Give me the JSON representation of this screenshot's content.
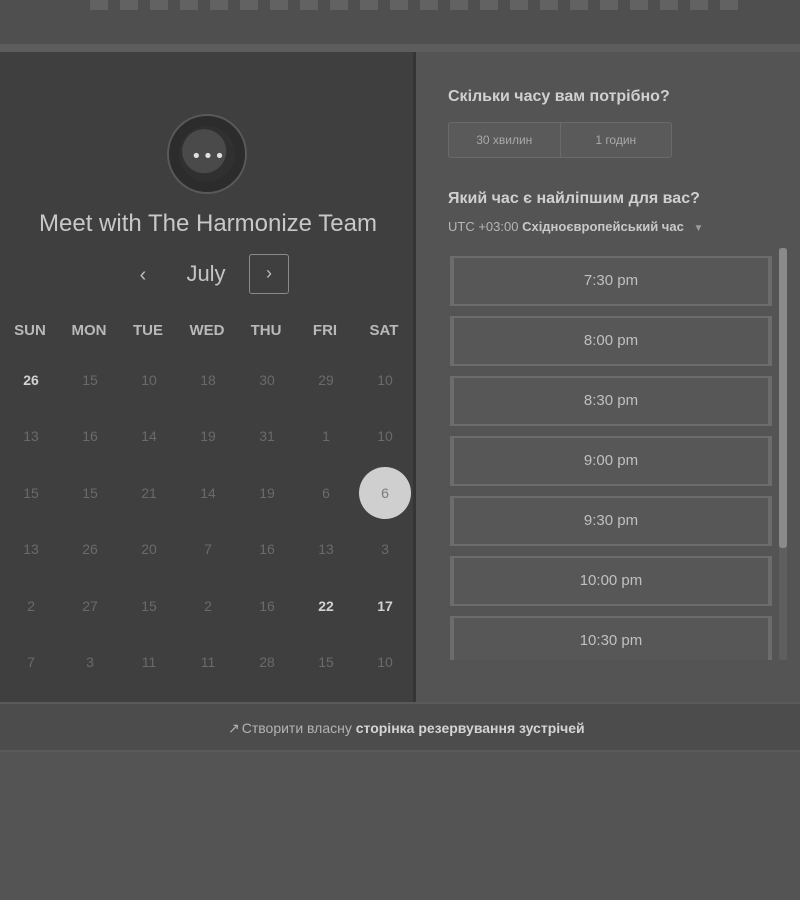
{
  "calendar": {
    "title": "Meet with The Harmonize Team",
    "month": "July",
    "prev_icon": "‹",
    "next_icon": "›",
    "weekdays": [
      "SUN",
      "MON",
      "TUE",
      "WED",
      "THU",
      "FRI",
      "SAT"
    ],
    "weeks": [
      [
        "26",
        "15",
        "10",
        "18",
        "30",
        "29",
        "10"
      ],
      [
        "13",
        "16",
        "14",
        "19",
        "31",
        "1",
        "10"
      ],
      [
        "15",
        "15",
        "21",
        "14",
        "19",
        "6",
        "6"
      ],
      [
        "13",
        "26",
        "20",
        "7",
        "16",
        "13",
        "3"
      ],
      [
        "2",
        "27",
        "15",
        "2",
        "16",
        "22",
        "17"
      ],
      [
        "7",
        "3",
        "11",
        "11",
        "28",
        "15",
        "10"
      ]
    ],
    "selected_day": "6"
  },
  "booking": {
    "duration_question": "Скільки часу вам потрібно?",
    "durations": [
      "30 хвилин",
      "1 годин"
    ],
    "time_question": "Який час є найліпшим для вас?",
    "timezone_offset": "UTC +03:00",
    "timezone_name": "Східноєвропейський час",
    "slots": [
      "7:30 pm",
      "8:00 pm",
      "8:30 pm",
      "9:00 pm",
      "9:30 pm",
      "10:00 pm",
      "10:30 pm"
    ]
  },
  "footer": {
    "prefix": "Створити власну",
    "link": "сторінка резервування зустрічей"
  },
  "icons": {
    "logo": "chat-bubble-logo-icon",
    "prev": "chevron-left-icon",
    "next": "chevron-right-icon",
    "tz": "caret-down-icon",
    "footer": "sparkle-icon"
  }
}
